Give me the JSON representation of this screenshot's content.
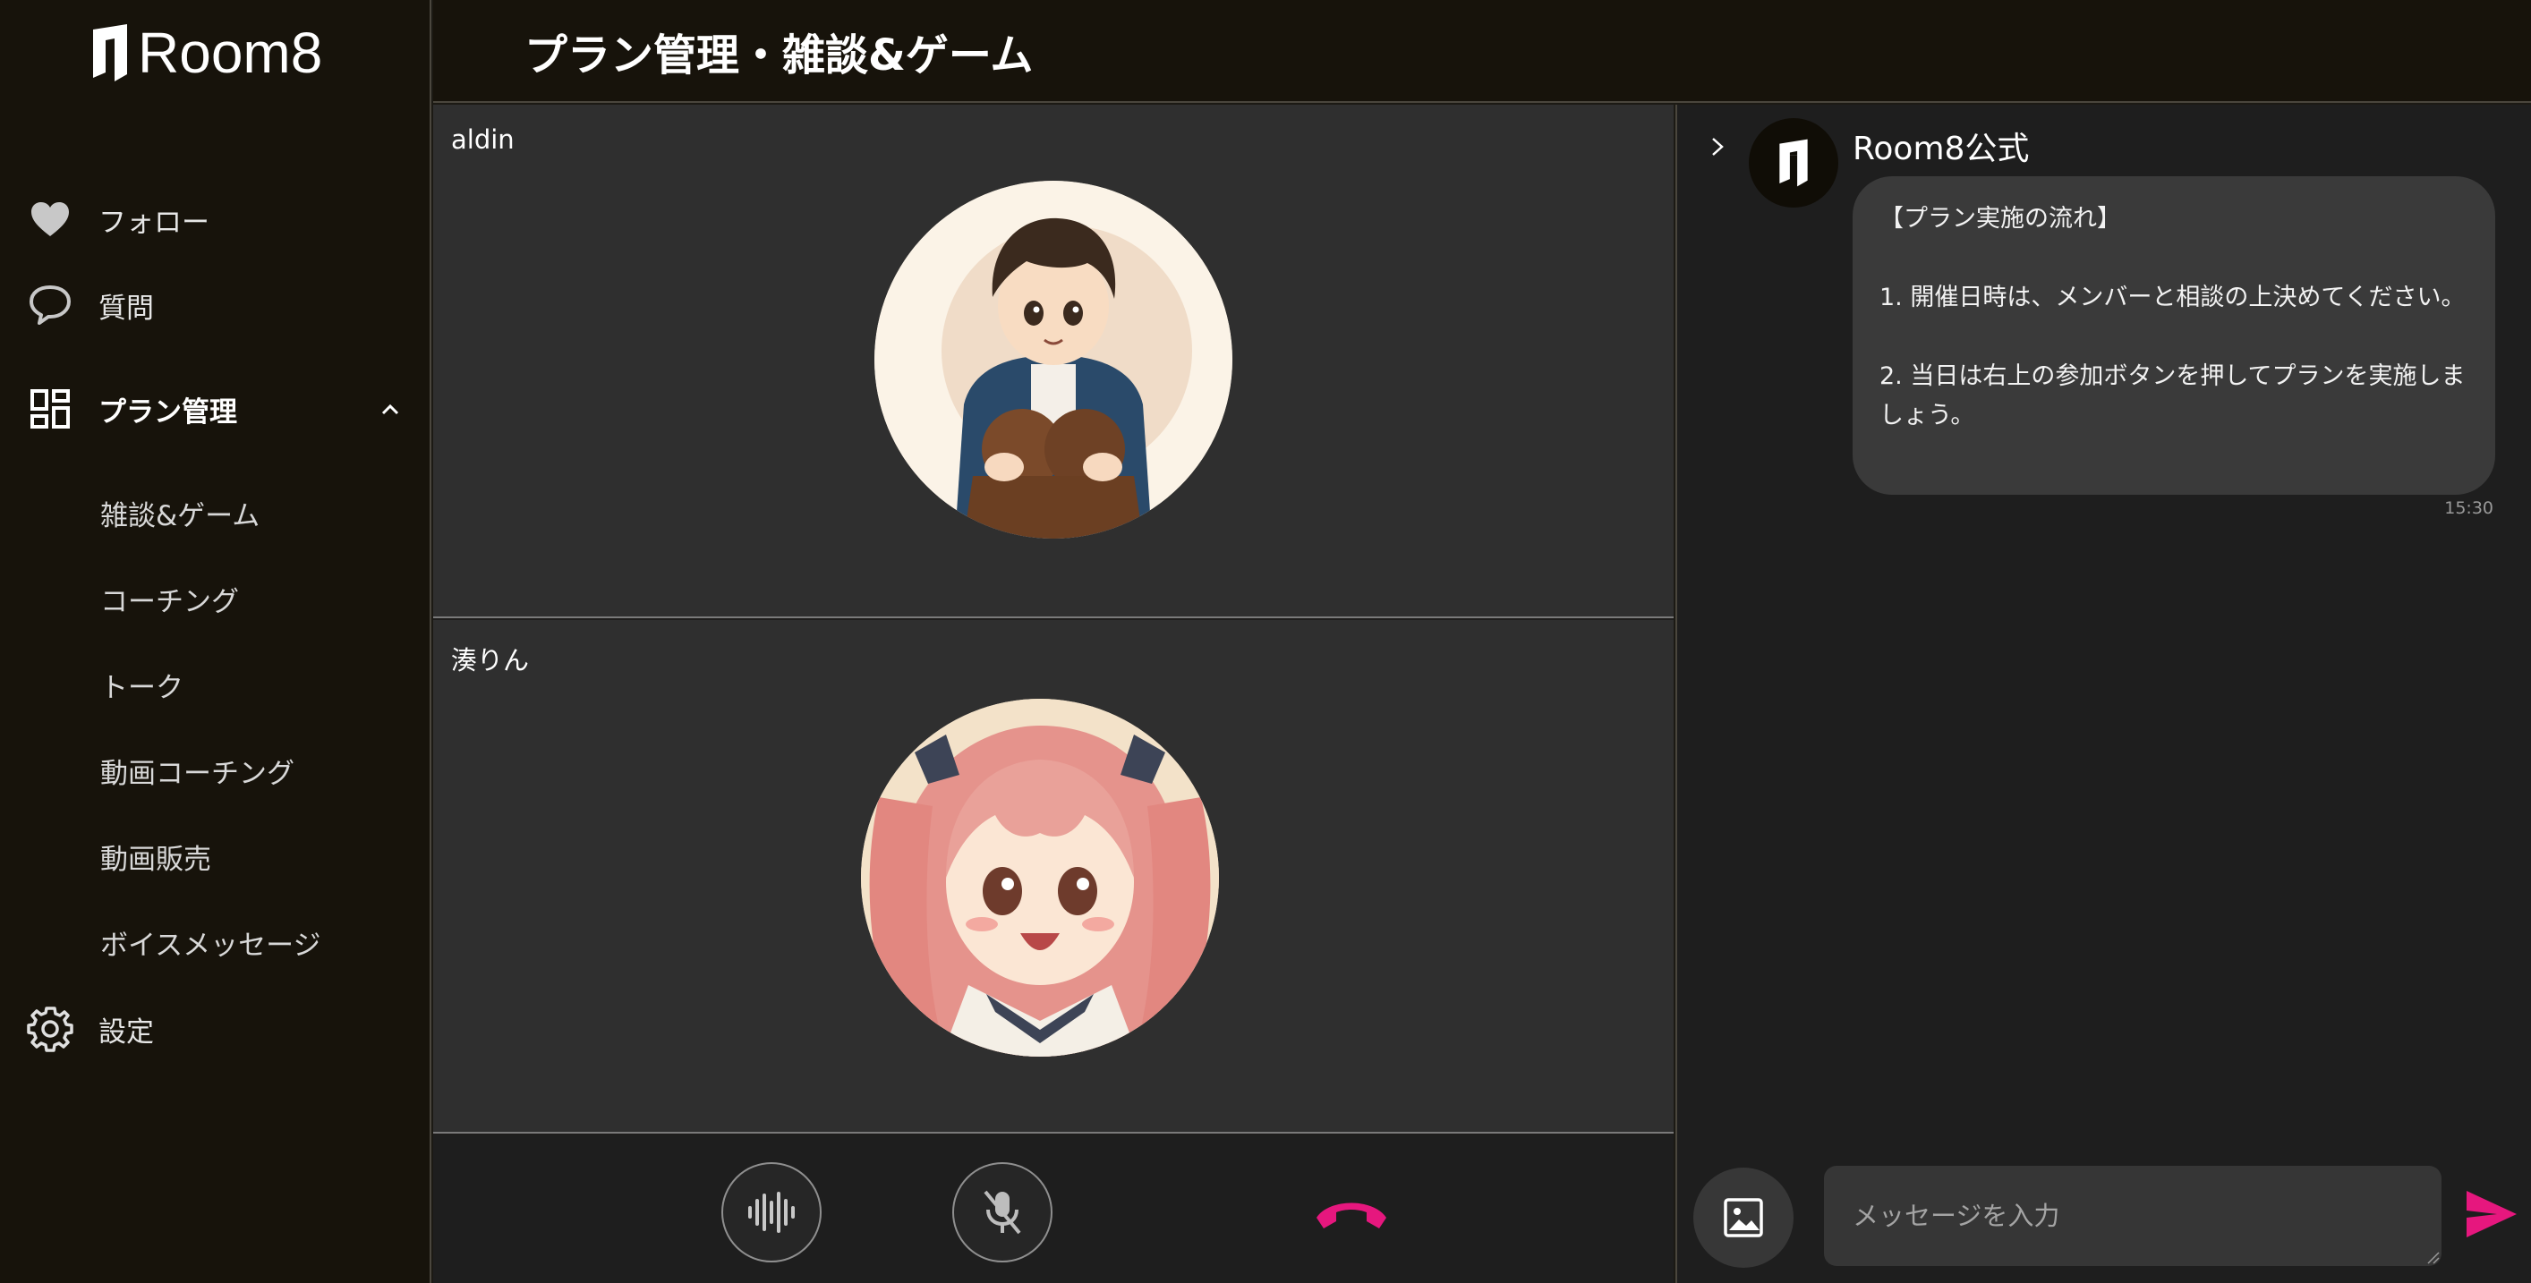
{
  "app": {
    "logo_text": "Room8"
  },
  "header": {
    "title": "プラン管理・雑談&ゲーム"
  },
  "sidebar": {
    "items": [
      {
        "label": "フォロー",
        "icon": "heart-icon"
      },
      {
        "label": "質問",
        "icon": "speech-bubble-icon"
      },
      {
        "label": "プラン管理",
        "icon": "dashboard-icon",
        "expanded": true
      },
      {
        "label": "設定",
        "icon": "gear-icon"
      }
    ],
    "sub_items": [
      "雑談&ゲーム",
      "コーチング",
      "トーク",
      "動画コーチング",
      "動画販売",
      "ボイスメッセージ"
    ]
  },
  "video": {
    "participants": [
      {
        "name": "aldin",
        "avatar": "boy-avatar-icon"
      },
      {
        "name": "湊りん",
        "avatar": "girl-avatar-icon"
      }
    ],
    "controls": [
      "audio-waveform-icon",
      "mic-off-icon",
      "hang-up-icon"
    ]
  },
  "chat": {
    "sender": "Room8公式",
    "message": "【プラン実施の流れ】\n\n1. 開催日時は、メンバーと相談の上決めてください。\n\n2. 当日は右上の参加ボタンを押してプランを実施しましょう。",
    "time": "15:30",
    "input_placeholder": "メッセージを入力"
  },
  "colors": {
    "sidebar_bg": "#17130b",
    "tile_bg": "#2f2f2f",
    "accent_pink": "#e6177e",
    "bubble_bg": "#3a3a3a"
  }
}
